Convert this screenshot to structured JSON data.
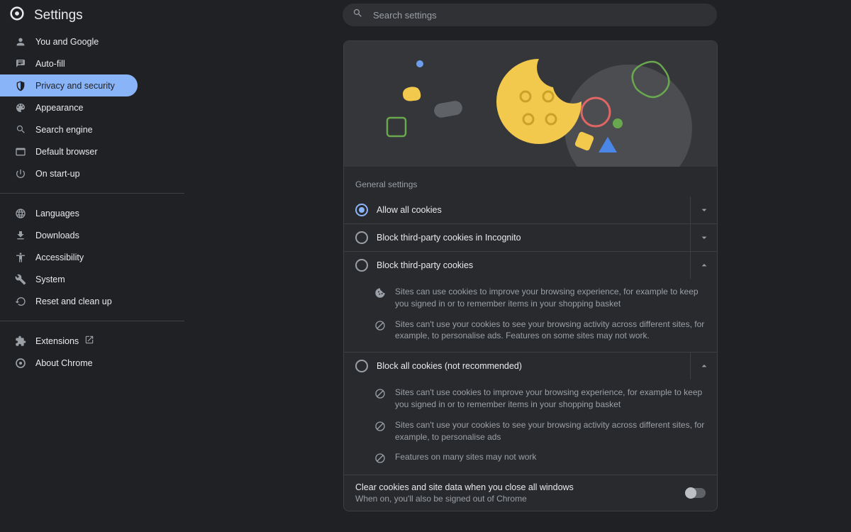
{
  "header": {
    "title": "Settings",
    "search_placeholder": "Search settings"
  },
  "sidebar": {
    "group1": [
      {
        "id": "you-and-google",
        "label": "You and Google"
      },
      {
        "id": "auto-fill",
        "label": "Auto-fill"
      },
      {
        "id": "privacy-and-security",
        "label": "Privacy and security",
        "active": true
      },
      {
        "id": "appearance",
        "label": "Appearance"
      },
      {
        "id": "search-engine",
        "label": "Search engine"
      },
      {
        "id": "default-browser",
        "label": "Default browser"
      },
      {
        "id": "on-start-up",
        "label": "On start-up"
      }
    ],
    "group2": [
      {
        "id": "languages",
        "label": "Languages"
      },
      {
        "id": "downloads",
        "label": "Downloads"
      },
      {
        "id": "accessibility",
        "label": "Accessibility"
      },
      {
        "id": "system",
        "label": "System"
      },
      {
        "id": "reset-and-clean-up",
        "label": "Reset and clean up"
      }
    ],
    "group3": [
      {
        "id": "extensions",
        "label": "Extensions",
        "external": true
      },
      {
        "id": "about-chrome",
        "label": "About Chrome"
      }
    ]
  },
  "main": {
    "section_title": "General settings",
    "options": [
      {
        "id": "allow-all",
        "label": "Allow all cookies",
        "selected": true,
        "expanded": false,
        "details": []
      },
      {
        "id": "block-tp-incognito",
        "label": "Block third-party cookies in Incognito",
        "selected": false,
        "expanded": false,
        "details": []
      },
      {
        "id": "block-tp",
        "label": "Block third-party cookies",
        "selected": false,
        "expanded": true,
        "details": [
          {
            "icon": "cookie",
            "text": "Sites can use cookies to improve your browsing experience, for example to keep you signed in or to remember items in your shopping basket"
          },
          {
            "icon": "block",
            "text": "Sites can't use your cookies to see your browsing activity across different sites, for example, to personalise ads. Features on some sites may not work."
          }
        ]
      },
      {
        "id": "block-all",
        "label": "Block all cookies (not recommended)",
        "selected": false,
        "expanded": true,
        "details": [
          {
            "icon": "block",
            "text": "Sites can't use cookies to improve your browsing experience, for example to keep you signed in or to remember items in your shopping basket"
          },
          {
            "icon": "block",
            "text": "Sites can't use your cookies to see your browsing activity across different sites, for example, to personalise ads"
          },
          {
            "icon": "block",
            "text": "Features on many sites may not work"
          }
        ]
      }
    ],
    "clear_cookies": {
      "title": "Clear cookies and site data when you close all windows",
      "subtitle": "When on, you'll also be signed out of Chrome",
      "enabled": false
    }
  }
}
